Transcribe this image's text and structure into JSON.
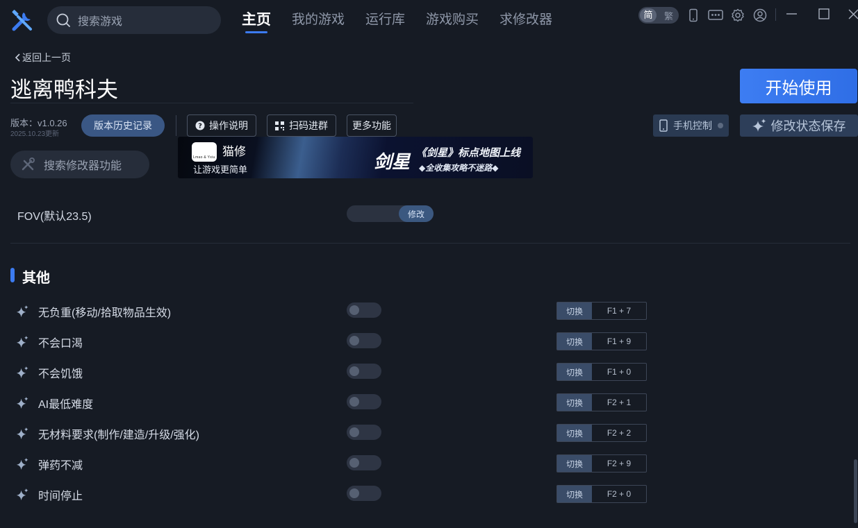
{
  "top_bar": {
    "search_placeholder": "搜索游戏",
    "nav": [
      {
        "label": "主页",
        "active": true
      },
      {
        "label": "我的游戏",
        "active": false
      },
      {
        "label": "运行库",
        "active": false
      },
      {
        "label": "游戏购买",
        "active": false
      },
      {
        "label": "求修改器",
        "active": false
      }
    ],
    "lang_simplified": "简",
    "lang_traditional": "繁",
    "icons": [
      "phone-icon",
      "message-icon",
      "gear-icon",
      "user-icon",
      "minimize-icon",
      "maximize-icon",
      "close-icon"
    ]
  },
  "header": {
    "back_label": "返回上一页",
    "game_title": "逃离鸭科夫",
    "start_button": "开始使用",
    "version": "版本：v1.0.26",
    "version_date": "2025.10.23更新",
    "history_button": "版本历史记录",
    "help_button": "操作说明",
    "qr_button": "扫码进群",
    "more_button": "更多功能",
    "phone_control_button": "手机控制",
    "save_state_button": "修改状态保存",
    "mod_search_placeholder": "搜索修改器功能"
  },
  "banner": {
    "brand": "猫修",
    "brand_sub": "Lmao & Yxiu",
    "brand_slogan": "让游戏更简单",
    "game_logo": "剑星",
    "headline": "《剑星》标点地图上线",
    "subline": "◆全收集攻略不迷路◆"
  },
  "fov": {
    "label": "FOV(默认23.5)",
    "button": "修改"
  },
  "section": {
    "title": "其他"
  },
  "cheats": [
    {
      "label": "无负重(移动/拾取物品生效)",
      "switch": "切换",
      "hotkey": "F1 + 7",
      "enabled": false
    },
    {
      "label": "不会口渴",
      "switch": "切换",
      "hotkey": "F1 + 9",
      "enabled": false
    },
    {
      "label": "不会饥饿",
      "switch": "切换",
      "hotkey": "F1 + 0",
      "enabled": false
    },
    {
      "label": "AI最低难度",
      "switch": "切换",
      "hotkey": "F2 + 1",
      "enabled": false
    },
    {
      "label": "无材料要求(制作/建造/升级/强化)",
      "switch": "切换",
      "hotkey": "F2 + 2",
      "enabled": false
    },
    {
      "label": "弹药不减",
      "switch": "切换",
      "hotkey": "F2 + 9",
      "enabled": false
    },
    {
      "label": "时间停止",
      "switch": "切换",
      "hotkey": "F2 + 0",
      "enabled": false
    }
  ],
  "colors": {
    "background": "#161b24",
    "accent": "#3c7bf0",
    "panel": "#262d3a"
  }
}
